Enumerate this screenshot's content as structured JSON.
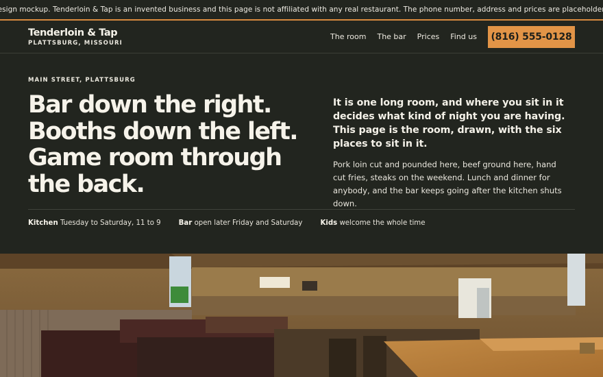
{
  "banner": "Design mockup. Tenderloin & Tap is an invented business and this page is not affiliated with any real restaurant. The phone number, address and prices are placeholders.",
  "brand": {
    "name": "Tenderloin & Tap",
    "location": "PLATTSBURG, MISSOURI"
  },
  "nav": {
    "links": [
      "The room",
      "The bar",
      "Prices",
      "Find us"
    ],
    "phone": "(816) 555-0128"
  },
  "hero": {
    "eyebrow": "MAIN STREET, PLATTSBURG",
    "headline": [
      "Bar down the right.",
      "Booths down the left.",
      "Game room through",
      "the back."
    ],
    "lede": "It is one long room, and where you sit in it decides what kind of night you are having. This page is the room, drawn, with the six places to sit in it.",
    "body": "Pork loin cut and pounded here, beef ground here, hand cut fries, steaks on the weekend. Lunch and dinner for anybody, and the bar keeps going after the kitchen shuts down.",
    "facts": [
      {
        "label": "Kitchen",
        "value": "Tuesday to Saturday, 11 to 9"
      },
      {
        "label": "Bar",
        "value": "open later Friday and Saturday"
      },
      {
        "label": "Kids",
        "value": "welcome the whole time"
      }
    ]
  },
  "colors": {
    "accent": "#e29447",
    "background": "#22251f"
  }
}
